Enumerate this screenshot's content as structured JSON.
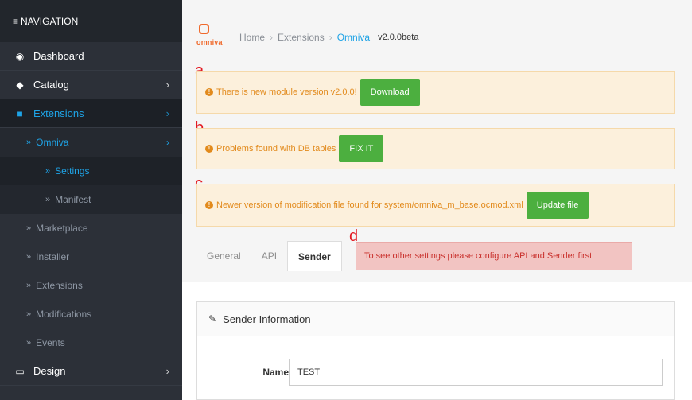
{
  "sidebar": {
    "header": "NAVIGATION",
    "items": [
      {
        "label": "Dashboard",
        "icon": "dashboard-icon"
      },
      {
        "label": "Catalog",
        "icon": "tags-icon"
      },
      {
        "label": "Extensions",
        "icon": "puzzle-icon"
      },
      {
        "label": "Design",
        "icon": "monitor-icon"
      }
    ],
    "sub": {
      "omniva": "Omniva",
      "settings": "Settings",
      "manifest": "Manifest",
      "marketplace": "Marketplace",
      "installer": "Installer",
      "extensions": "Extensions",
      "modifications": "Modifications",
      "events": "Events"
    }
  },
  "header": {
    "logo_text": "omniva",
    "breadcrumbs": [
      "Home",
      "Extensions",
      "Omniva"
    ],
    "version": "v2.0.0beta"
  },
  "alerts": [
    {
      "letter": "a",
      "text": "There is new module version v2.0.0!",
      "button": "Download"
    },
    {
      "letter": "b",
      "text": "Problems found with DB tables",
      "button": "FIX IT"
    },
    {
      "letter": "c",
      "text": "Newer version of modification file found for system/omniva_m_base.ocmod.xml",
      "button": "Update file"
    }
  ],
  "tabs": {
    "items": [
      "General",
      "API",
      "Sender"
    ],
    "active": "Sender",
    "letter": "d",
    "warning": "To see other settings please configure API and Sender first"
  },
  "panel": {
    "title": "Sender Information",
    "fields": [
      {
        "label": "Name",
        "value": "TEST"
      }
    ]
  },
  "colors": {
    "sidebar_bg": "#2c3038",
    "accent_blue": "#1ea3e6",
    "brand_orange": "#f0692b",
    "warning_bg": "#fcf0dc",
    "warning_text": "#e28a1c",
    "button_green": "#4caf3f",
    "danger_bg": "#f2c4c2",
    "danger_text": "#c9302c",
    "annotation_red": "#e31b23"
  }
}
